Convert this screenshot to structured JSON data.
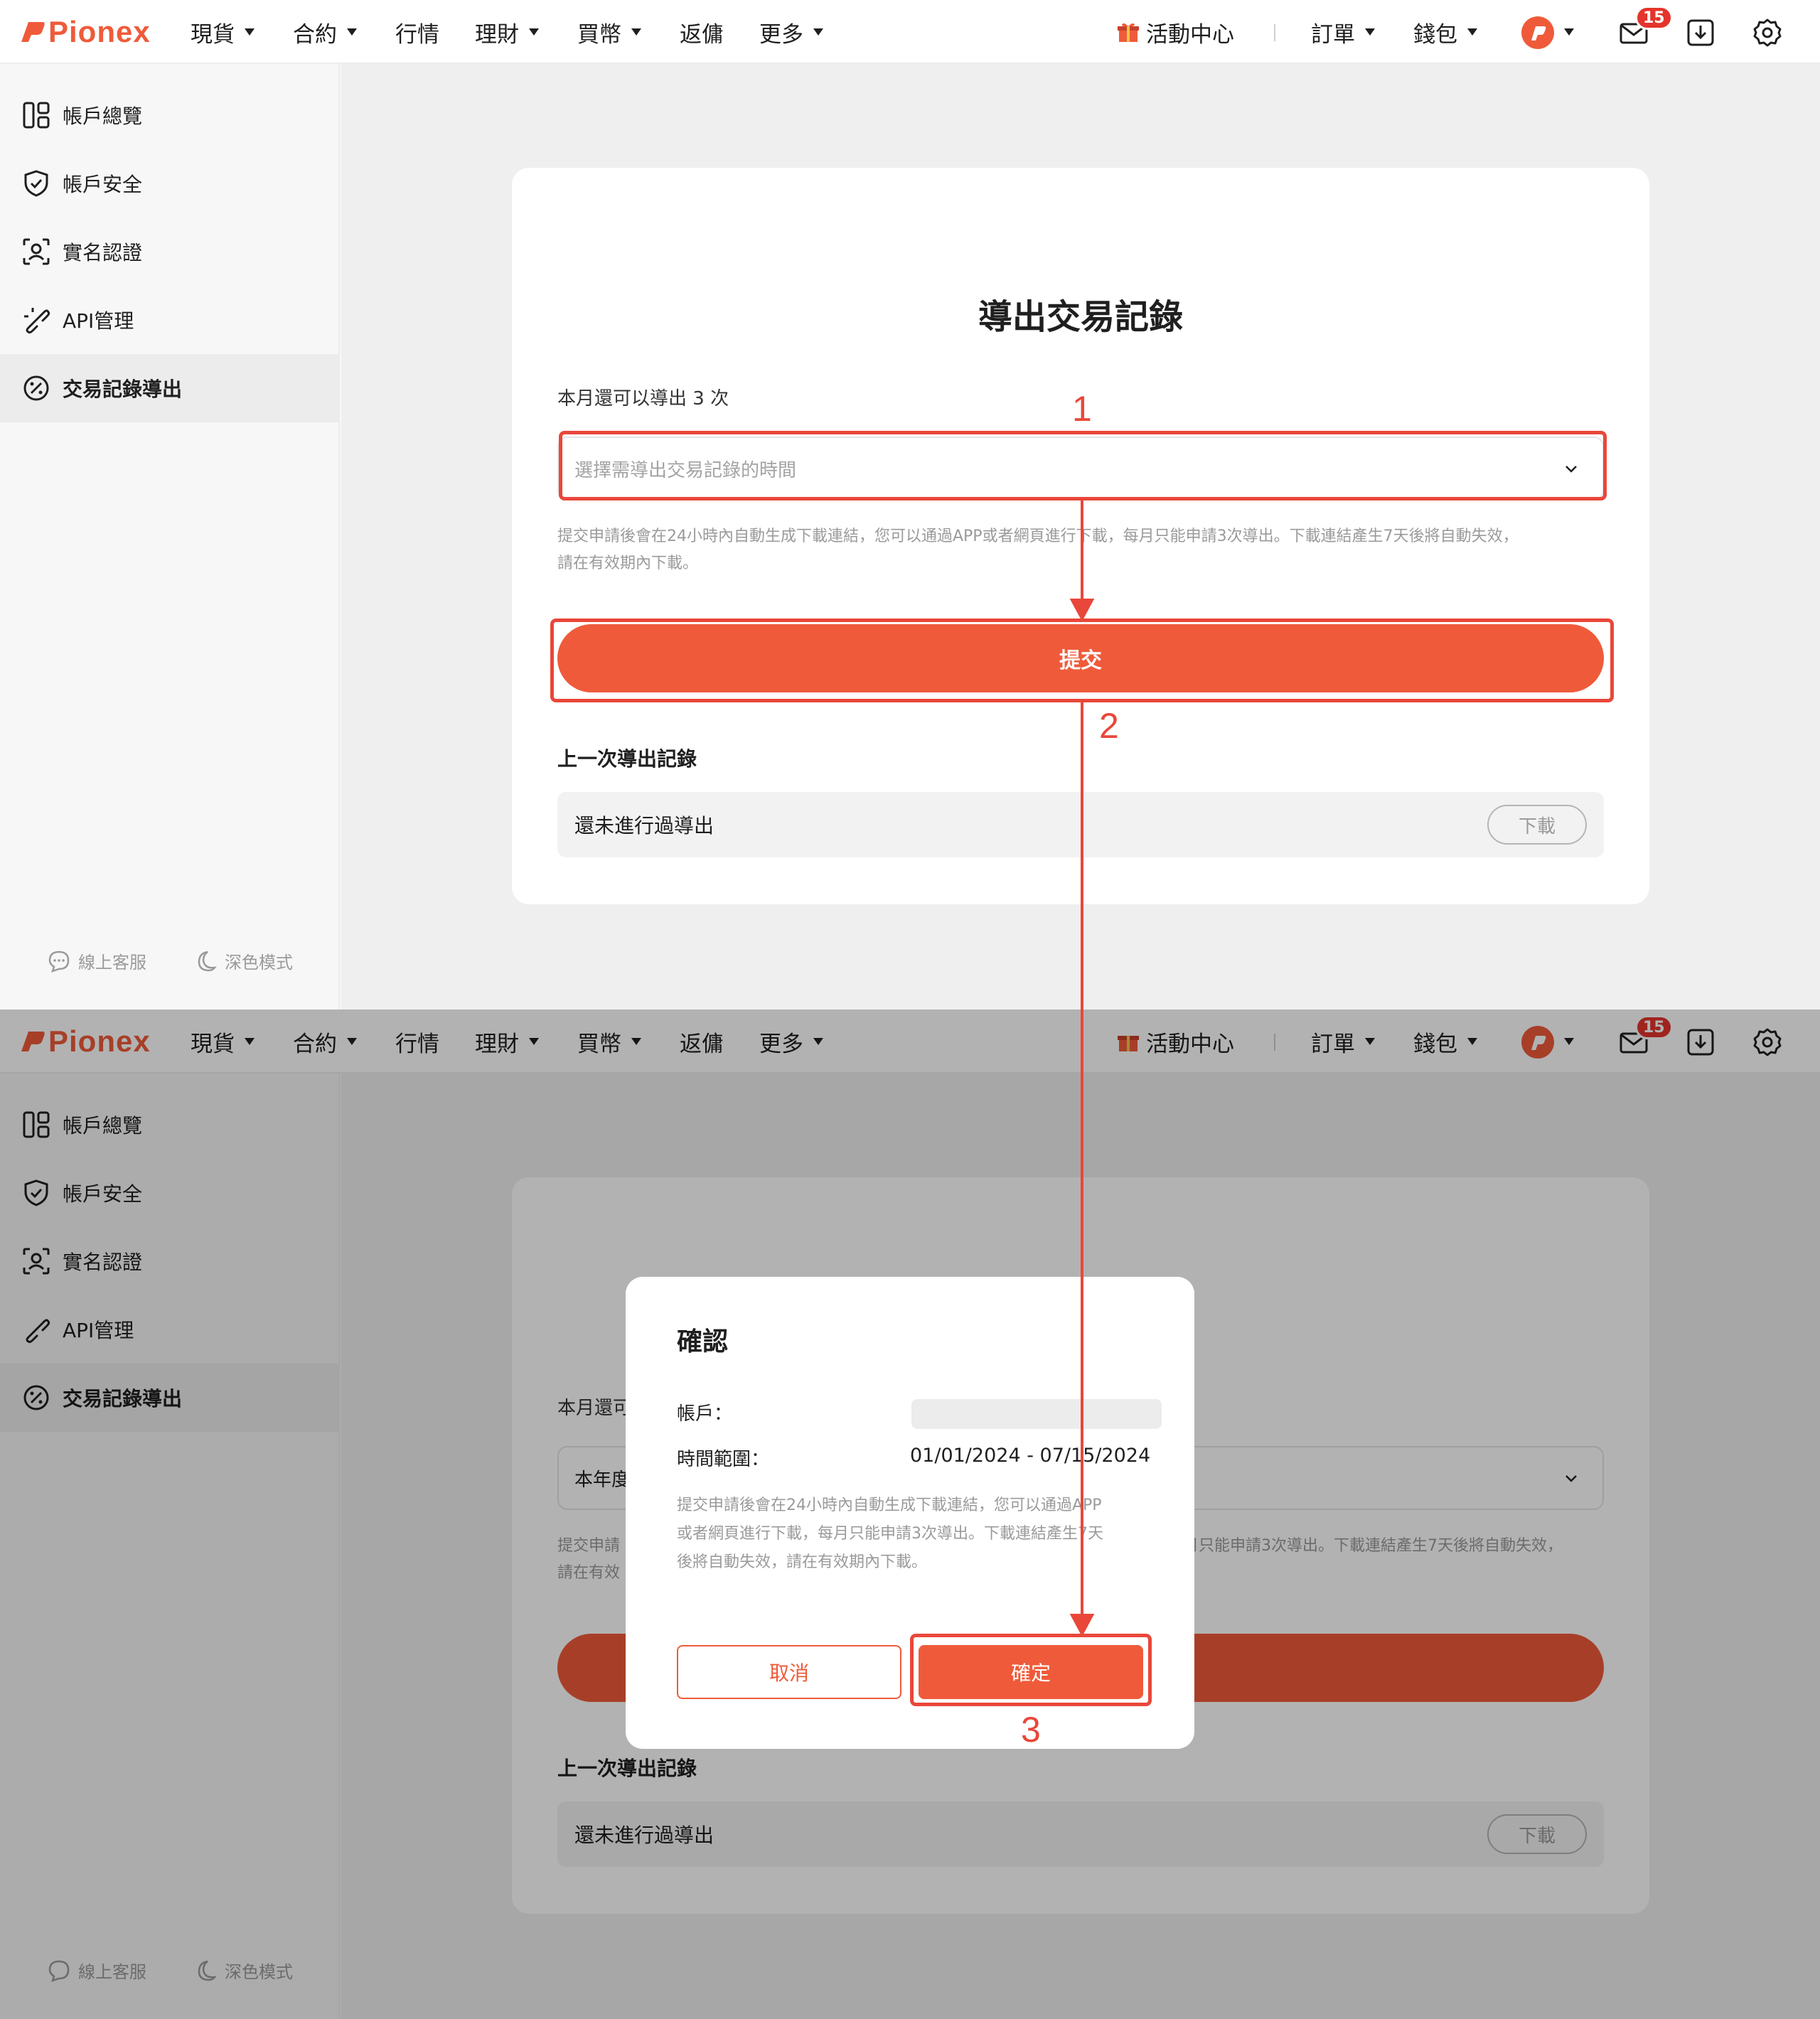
{
  "brand": {
    "name": "Pionex",
    "accent": "#ef5b3a"
  },
  "nav": {
    "items": [
      "現貨",
      "合約",
      "行情",
      "理財",
      "買幣",
      "返傭",
      "更多"
    ],
    "activity": "活動中心",
    "orders": "訂單",
    "wallet": "錢包",
    "mail_badge": "15"
  },
  "sidebar": {
    "items": [
      {
        "label": "帳戶總覽",
        "icon": "overview-icon"
      },
      {
        "label": "帳戶安全",
        "icon": "shield-icon"
      },
      {
        "label": "實名認證",
        "icon": "id-verify-icon"
      },
      {
        "label": "API管理",
        "icon": "api-link-icon"
      },
      {
        "label": "交易記錄導出",
        "icon": "export-record-icon"
      }
    ],
    "support": "線上客服",
    "dark_mode": "深色模式"
  },
  "export": {
    "title": "導出交易記錄",
    "remaining": "本月還可以導出 3 次",
    "select_placeholder": "選擇需導出交易記錄的時間",
    "hint_line1": "提交申請後會在24小時內自動生成下載連結，您可以通過APP或者網頁進行下載，每月只能申請3次導出。下載連結產生7天後將自動失效，",
    "hint_line2": "請在有效期內下載。",
    "submit": "提交",
    "last_title": "上一次導出記錄",
    "last_empty": "還未進行過導出",
    "download": "下載"
  },
  "background_page": {
    "remaining_partial": "本月還可",
    "select_partial": "本年度",
    "hint_partial_left_1": "提交申請",
    "hint_partial_left_2": "請在有效",
    "hint_partial_right": "月只能申請3次導出。下載連結產生7天後將自動失效，"
  },
  "modal": {
    "title": "確認",
    "account_label": "帳戶：",
    "range_label": "時間範圍：",
    "range_value": "01/01/2024 - 07/15/2024",
    "hint_line1": "提交申請後會在24小時內自動生成下載連結，您可以通過APP",
    "hint_line2": "或者網頁進行下載，每月只能申請3次導出。下載連結產生7天",
    "hint_line3": "後將自動失效，請在有效期內下載。",
    "cancel": "取消",
    "confirm": "確定"
  },
  "annotations": {
    "step1": "1",
    "step2": "2",
    "step3": "3"
  }
}
